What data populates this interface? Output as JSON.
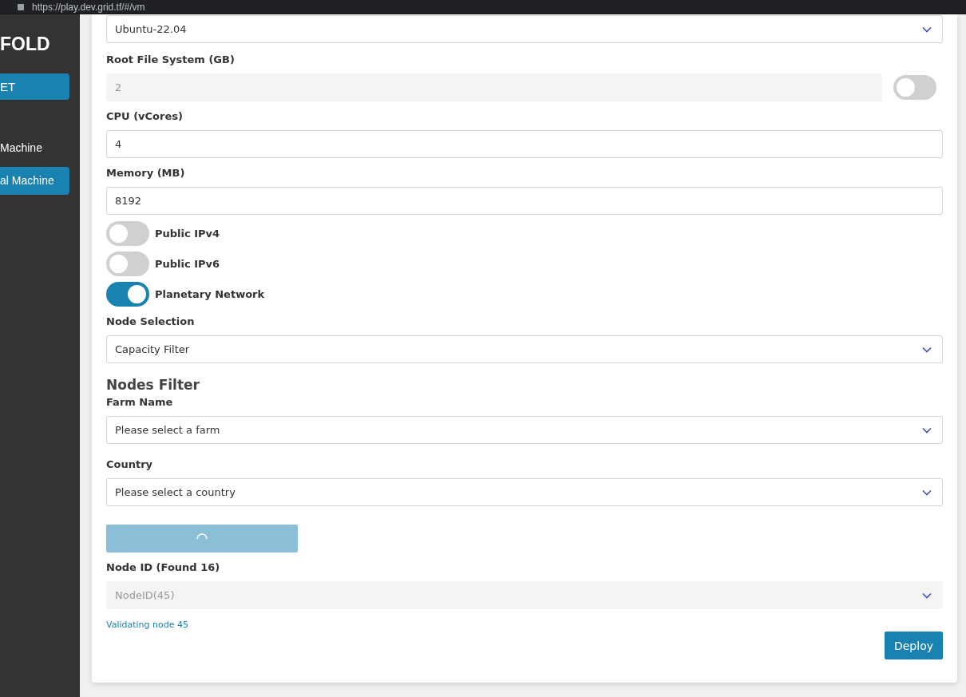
{
  "browser": {
    "address": "https://play.dev.grid.tf/#/vm"
  },
  "sidebar": {
    "title": "FOLD",
    "button": "ET",
    "items": [
      {
        "label": "Machine",
        "selected": false
      },
      {
        "label": "al Machine",
        "selected": true
      }
    ]
  },
  "form": [
    {
      "kind": "select",
      "value": "Ubuntu-22.04",
      "disabled": false
    },
    {
      "kind": "input",
      "label": "Root File System (GB)",
      "value": "2",
      "disabled": true,
      "switch_on": false
    },
    {
      "kind": "input",
      "label": "CPU (vCores)",
      "value": "4",
      "disabled": false
    },
    {
      "kind": "input",
      "label": "Memory (MB)",
      "value": "8192",
      "disabled": false
    },
    {
      "kind": "toggle",
      "label": "Public IPv4",
      "on": false
    },
    {
      "kind": "toggle",
      "label": "Public IPv6",
      "on": false
    },
    {
      "kind": "toggle",
      "label": "Planetary Network",
      "on": true
    },
    {
      "kind": "select",
      "label": "Node Selection",
      "value": "Capacity Filter",
      "disabled": false
    },
    {
      "kind": "heading",
      "text": "Nodes Filter"
    },
    {
      "kind": "select",
      "label": "Farm Name",
      "value": "Please select a farm",
      "disabled": false
    },
    {
      "kind": "select",
      "label": "Country",
      "value": "Please select a country",
      "disabled": false
    },
    {
      "kind": "loading_button",
      "loading": true
    },
    {
      "kind": "select",
      "label": "Node ID (Found 16)",
      "value": "NodeID(45)",
      "disabled": true
    },
    {
      "kind": "hint",
      "text": "Validating node 45"
    }
  ],
  "deploy_button": "Deploy"
}
